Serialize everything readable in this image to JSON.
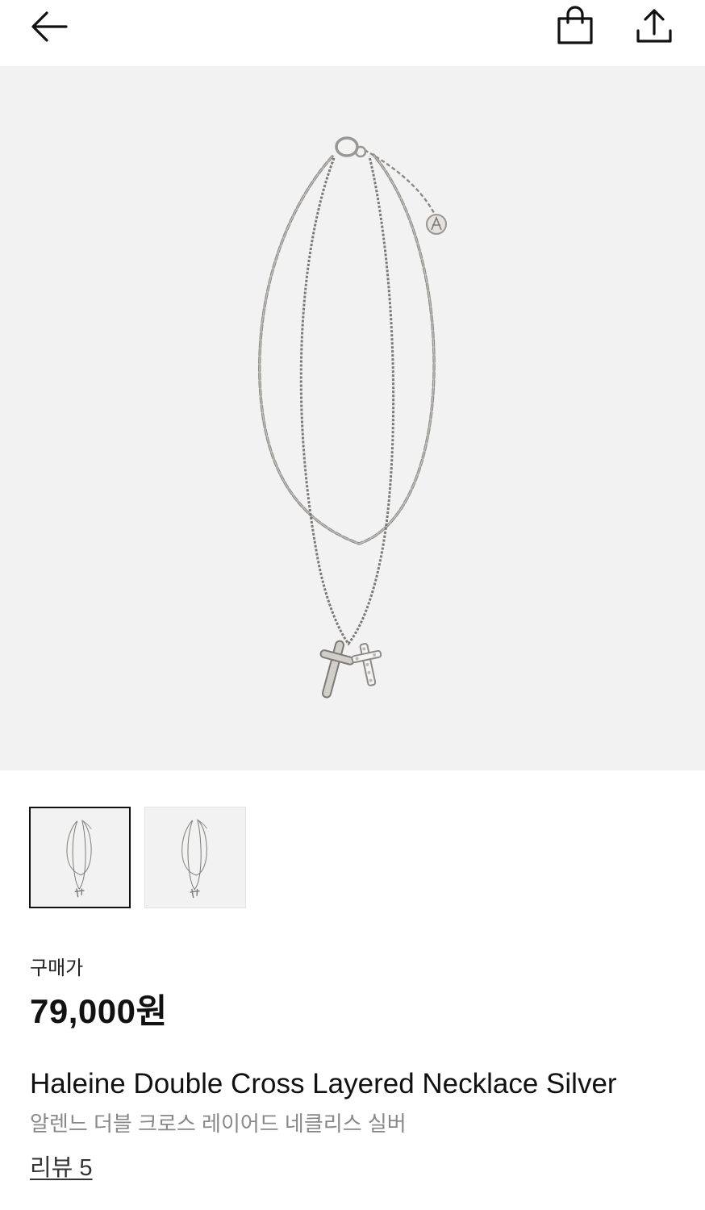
{
  "header": {
    "back_icon": "arrow-left-icon",
    "bag_icon": "shopping-bag-icon",
    "share_icon": "share-upload-icon"
  },
  "gallery": {
    "hero_image": "silver double-chain necklace with two cross pendants",
    "thumbnails": [
      {
        "selected": true
      },
      {
        "selected": false
      }
    ]
  },
  "product": {
    "price_label": "구매가",
    "price": "79,000원",
    "name_en": "Haleine Double Cross Layered Necklace Silver",
    "name_ko": "알렌느 더블 크로스 레이어드 네클리스 실버",
    "review_label": "리뷰 5"
  },
  "colors": {
    "image_bg": "#f2f2f2",
    "text_primary": "#111111",
    "text_secondary": "#888888"
  }
}
